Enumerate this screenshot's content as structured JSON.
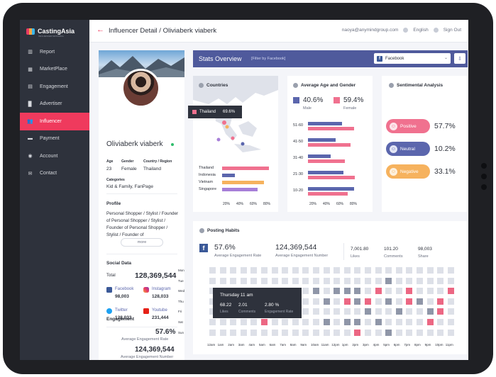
{
  "app": {
    "logo": "CastingAsia",
    "logo_sub": "INFLUENCER MATCHING"
  },
  "sidebar": {
    "items": [
      {
        "label": "Report",
        "icon": "bar-chart-icon"
      },
      {
        "label": "MarketPlace",
        "icon": "grid-icon"
      },
      {
        "label": "Engagement",
        "icon": "engagement-icon"
      },
      {
        "label": "Advertiser",
        "icon": "building-icon"
      },
      {
        "label": "Influencer",
        "icon": "users-icon"
      },
      {
        "label": "Payment",
        "icon": "card-icon"
      },
      {
        "label": "Account",
        "icon": "account-icon"
      },
      {
        "label": "Contact",
        "icon": "mail-icon"
      }
    ],
    "active": "Influencer"
  },
  "header": {
    "title": "Influencer Detail / Oliviaberk viaberk",
    "email": "naoya@anymindgroup.com",
    "language": "English",
    "signout": "Sign Out"
  },
  "profile": {
    "name": "Oliviaberk viaberk",
    "age_label": "Age",
    "age": "23",
    "gender_label": "Gender",
    "gender": "Female",
    "country_label": "Country / Region",
    "country": "Thailand",
    "categories_label": "Categories",
    "categories": "Kid & Family, FanPage",
    "profile_label": "Profile",
    "bio": "Personal Shopper / Stylist / Founder of Personal Shopper / Stylist / Founder of Personal Shopper / Stylist / Founder of",
    "more": "more",
    "social_label": "Social Data",
    "total_label": "Total",
    "total": "128,369,544",
    "facebook_label": "Facebook",
    "facebook": "98,003",
    "instagram_label": "Instagram",
    "instagram": "128,033",
    "twitter_label": "Twitter",
    "twitter": "128,033",
    "youtube_label": "Youtube",
    "youtube": "231,444",
    "engagement_label": "Engagement",
    "eng_rate": "57.6%",
    "eng_rate_label": "Average Engagement Rate",
    "eng_num": "124,369,544",
    "eng_num_label": "Average Engagement Number"
  },
  "stats": {
    "title": "Stats Overview",
    "filter": "[Filter by Facebook]",
    "select": "Facebook"
  },
  "countries": {
    "title": "Countries",
    "tooltip_country": "Thailand",
    "tooltip_value": "69.6%",
    "items": [
      {
        "name": "Thailand",
        "value": 92,
        "color": "#f0718f"
      },
      {
        "name": "Indonesia",
        "value": 25,
        "color": "#5b66ad"
      },
      {
        "name": "Vietnam",
        "value": 82,
        "color": "#f6b25e"
      },
      {
        "name": "Singapore",
        "value": 70,
        "color": "#a77fd8"
      }
    ],
    "ticks": [
      "20%",
      "40%",
      "60%",
      "80%"
    ]
  },
  "age_gender": {
    "title": "Average Age and Gender",
    "male_pct": "40.6%",
    "male": "Male",
    "female_pct": "59.4%",
    "female": "Female",
    "groups": [
      {
        "label": "51-60",
        "male": 66,
        "female": 90
      },
      {
        "label": "41-50",
        "male": 54,
        "female": 84
      },
      {
        "label": "31-40",
        "male": 44,
        "female": 72
      },
      {
        "label": "21-30",
        "male": 70,
        "female": 92
      },
      {
        "label": "10-20",
        "male": 90,
        "female": 78
      }
    ],
    "ticks": [
      "20%",
      "40%",
      "60%",
      "80%"
    ],
    "male_color": "#5b66ad",
    "female_color": "#f0718f"
  },
  "sentiment": {
    "title": "Sentimental Analysis",
    "items": [
      {
        "label": "Positive",
        "value": "57.7%",
        "color": "#f0718f",
        "dot": "#fce4ea"
      },
      {
        "label": "Neutral",
        "value": "10.2%",
        "color": "#5b66ad",
        "dot": "#e3e6f5"
      },
      {
        "label": "Negative",
        "value": "33.1%",
        "color": "#f6b25e",
        "dot": "#fdf0de"
      }
    ]
  },
  "posting": {
    "title": "Posting Habits",
    "eng_rate": "57.6%",
    "eng_rate_label": "Average Engagement Rate",
    "eng_num": "124,369,544",
    "eng_num_label": "Average Engagement Number",
    "likes": "7,001.80",
    "likes_label": "Likes",
    "comments": "101.20",
    "comments_label": "Comments",
    "shares": "98,003",
    "shares_label": "Share",
    "days": [
      "Mon",
      "Tue",
      "Wed",
      "Thu",
      "Fri",
      "Sat",
      "Sun"
    ],
    "hours": [
      "12am",
      "1am",
      "2am",
      "3am",
      "4am",
      "5am",
      "6am",
      "7am",
      "8am",
      "9am",
      "10am",
      "11am",
      "12pm",
      "1pm",
      "2pm",
      "3pm",
      "4pm",
      "5pm",
      "6pm",
      "7pm",
      "8pm",
      "9pm",
      "10pm",
      "11pm"
    ],
    "tooltip": {
      "title": "Thursday 11 am",
      "likes": "68.22",
      "likes_label": "Likes",
      "comments": "2.01",
      "comments_label": "Comments",
      "rate": "2.80 %",
      "rate_label": "Engagement Rate"
    }
  }
}
